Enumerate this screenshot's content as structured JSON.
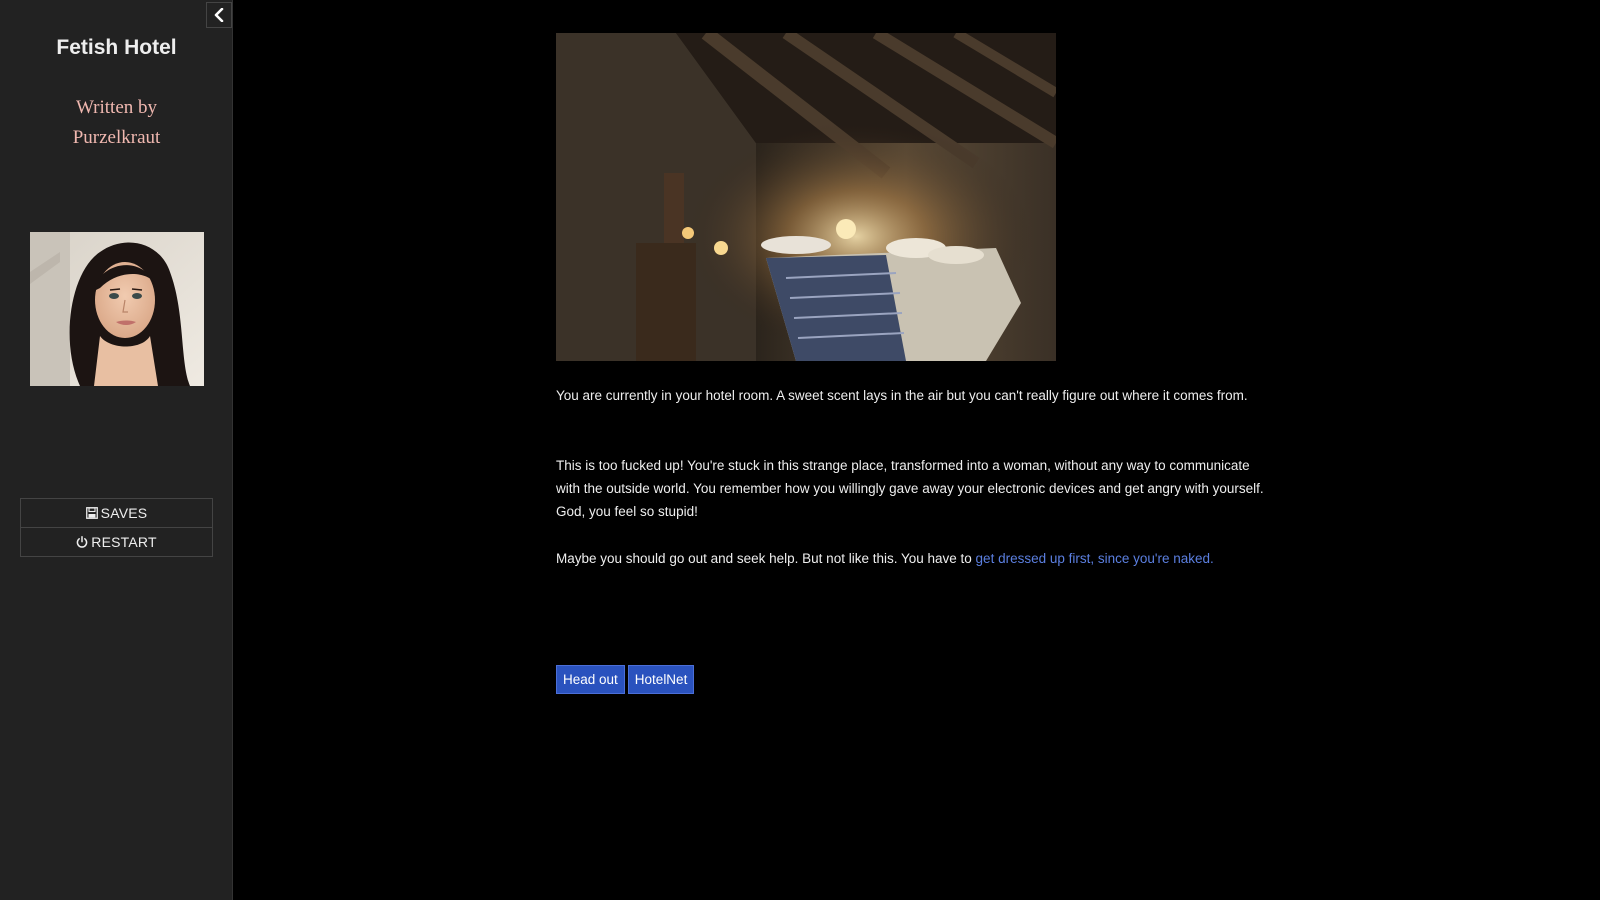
{
  "sidebar": {
    "title": "Fetish Hotel",
    "author_line1": "Written by",
    "author_line2": "Purzelkraut",
    "toggle_icon": "chevron-left-icon",
    "menu": [
      {
        "label": "SAVES",
        "icon": "save-icon"
      },
      {
        "label": "RESTART",
        "icon": "power-icon"
      }
    ]
  },
  "passage": {
    "p1": "You are currently in your hotel room. A sweet scent lays in the air but you can't really figure out where it comes from.",
    "p2": "This is too fucked up! You're stuck in this strange place, transformed into a woman, without any way to communicate with the outside world. You remember how you willingly gave away your electronic devices and get angry with yourself. God, you feel so stupid!",
    "p3_text": "Maybe you should go out and seek help. But not like this. You have to ",
    "p3_link": "get dressed up first, since you're naked.",
    "buttons": [
      "Head out",
      "HotelNet"
    ]
  },
  "colors": {
    "background": "#000000",
    "sidebar": "#222222",
    "link": "#5b7fe0",
    "button": "#2a52be",
    "author": "#f0b8b0"
  }
}
